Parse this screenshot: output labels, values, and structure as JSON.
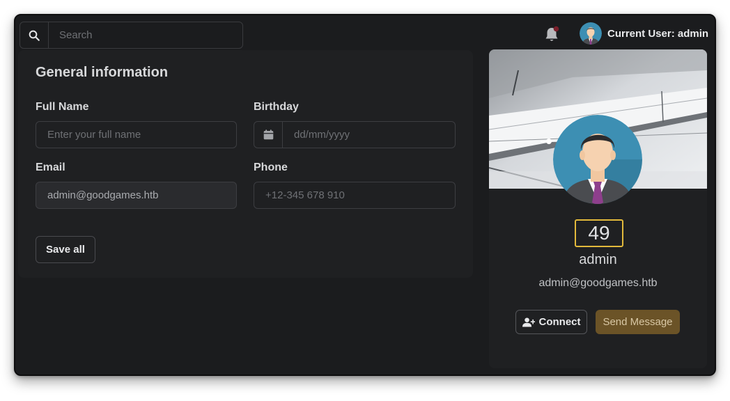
{
  "search": {
    "placeholder": "Search",
    "icon": "search-icon"
  },
  "header": {
    "notification_icon": "bell-icon",
    "notification_dot_color": "#7a1f2b",
    "current_user_label": "Current User: admin"
  },
  "general": {
    "title": "General information",
    "full_name": {
      "label": "Full Name",
      "placeholder": "Enter your full name",
      "value": ""
    },
    "birthday": {
      "label": "Birthday",
      "placeholder": "dd/mm/yyyy",
      "icon": "calendar-icon",
      "value": ""
    },
    "email": {
      "label": "Email",
      "value": "admin@goodgames.htb"
    },
    "phone": {
      "label": "Phone",
      "placeholder": "+12-345 678 910",
      "value": ""
    },
    "save_label": "Save all"
  },
  "profile": {
    "score": "49",
    "name": "admin",
    "email": "admin@goodgames.htb",
    "connect_label": "Connect",
    "message_label": "Send Message",
    "colors": {
      "score_border": "#e2b93b",
      "message_button": "#6b5327"
    }
  }
}
